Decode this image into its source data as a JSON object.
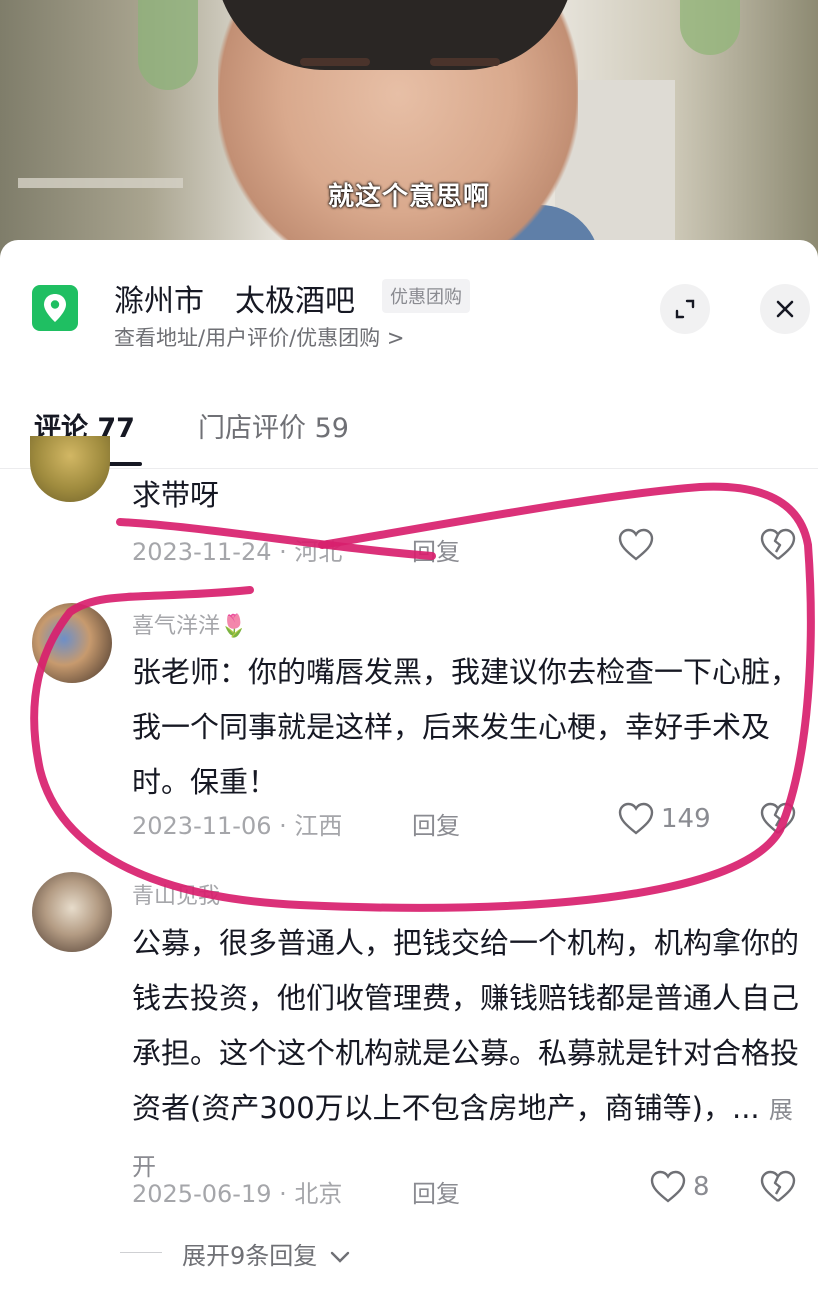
{
  "video": {
    "subtitle": "就这个意思啊"
  },
  "poi": {
    "city": "滁州市",
    "name": "太极酒吧",
    "tag": "优惠团购",
    "subtitle": "查看地址/用户评价/优惠团购 >",
    "icon": "location-pin-icon",
    "icon_color": "#1fbf62"
  },
  "header_buttons": {
    "expand_icon": "expand-icon",
    "close_icon": "close-icon"
  },
  "tabs": [
    {
      "label": "评论 77",
      "active": true
    },
    {
      "label": "门店评价 59",
      "active": false
    }
  ],
  "comments": [
    {
      "text": "求带呀",
      "meta": "2023-11-24 · 河北",
      "reply": "回复"
    },
    {
      "username": "喜气洋洋🌷",
      "text": "张老师：你的嘴唇发黑，我建议你去检查一下心脏，我一个同事就是这样，后来发生心梗，幸好手术及时。保重！",
      "meta": "2023-11-06 · 江西",
      "reply": "回复",
      "likes": "149"
    },
    {
      "username": "青山见我",
      "text": "公募，很多普通人，把钱交给一个机构，机构拿你的钱去投资，他们收管理费，赚钱赔钱都是普通人自己承担。这个这个机构就是公募。私募就是针对合格投资者(资产300万以上不包含房地产，商铺等)，... ",
      "expand": "展开",
      "meta": "2025-06-19 · 北京",
      "reply": "回复",
      "likes": "8"
    }
  ],
  "more_replies": "展开9条回复",
  "colors": {
    "annotation": "#d8206e",
    "text_primary": "#161823",
    "text_secondary": "#a5a6aa"
  }
}
